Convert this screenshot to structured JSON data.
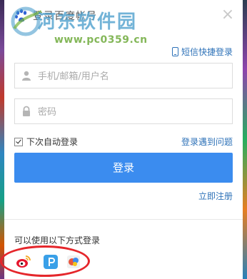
{
  "window": {
    "title": "登录百度帐号",
    "close_glyph": "×"
  },
  "watermark": {
    "site_name": "河东软件园",
    "url": "www.pc0359.cn"
  },
  "sms_login": {
    "label": "短信快捷登录",
    "icon": "phone-icon"
  },
  "form": {
    "username": {
      "placeholder": "手机/邮箱/用户名",
      "value": "",
      "icon": "user-icon"
    },
    "password": {
      "placeholder": "密码",
      "value": "",
      "icon": "lock-icon"
    },
    "remember_me": {
      "label": "下次自动登录",
      "checked": true
    },
    "login_problem": "登录遇到问题",
    "login_button": "登录",
    "register_link": "立即注册"
  },
  "other_login": {
    "label": "可以使用以下方式登录",
    "providers": [
      {
        "name": "weibo-icon"
      },
      {
        "name": "p-icon"
      },
      {
        "name": "third-party-icon"
      }
    ]
  },
  "colors": {
    "accent": "#3b8cef",
    "link": "#2e72b8",
    "annotation_ring": "#e5262b"
  }
}
